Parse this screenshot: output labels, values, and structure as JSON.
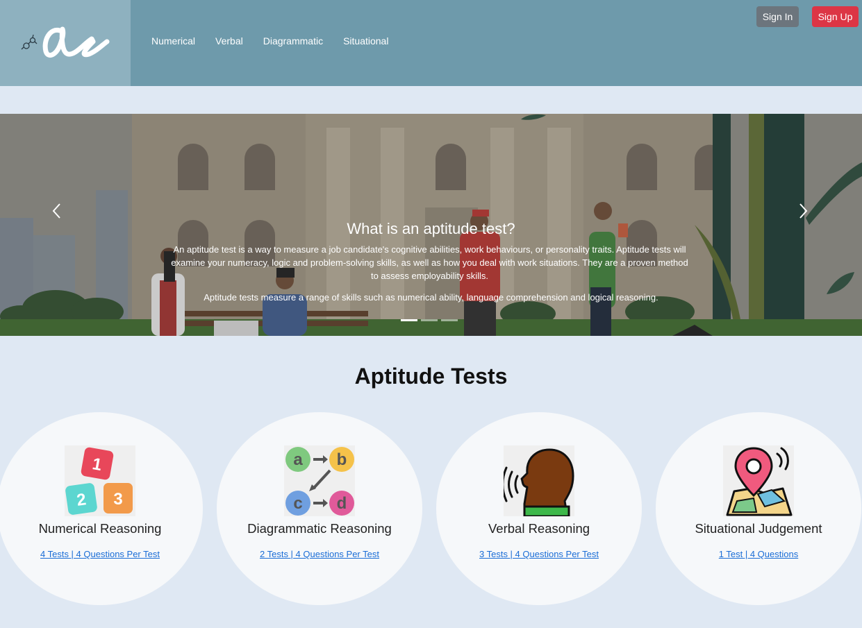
{
  "header": {
    "nav": [
      "Numerical",
      "Verbal",
      "Diagrammatic",
      "Situational"
    ],
    "sign_in": "Sign In",
    "sign_up": "Sign Up"
  },
  "hero": {
    "title": "What is an aptitude test?",
    "paragraph1": "An aptitude test is a way to measure a job candidate's cognitive abilities, work behaviours, or personality traits. Aptitude tests will examine your numeracy, logic and problem-solving skills, as well as how you deal with work situations. They are a proven method to assess employability skills.",
    "paragraph2": "Aptitude tests measure a range of skills such as numerical ability, language comprehension and logical reasoning.",
    "slides": 3,
    "active_slide": 1
  },
  "section": {
    "title": "Aptitude Tests"
  },
  "cards": [
    {
      "name": "Numerical Reasoning",
      "link": "4 Tests | 4 Questions Per Test",
      "icon": "number-blocks-icon"
    },
    {
      "name": "Diagrammatic Reasoning",
      "link": "2 Tests | 4 Questions Per Test",
      "icon": "abcd-diagram-icon"
    },
    {
      "name": "Verbal Reasoning",
      "link": "3 Tests | 4 Questions Per Test",
      "icon": "speaking-head-icon"
    },
    {
      "name": "Situational Judgement",
      "link": "1 Test | 4 Questions",
      "icon": "map-pin-icon"
    }
  ],
  "colors": {
    "header": "#6e9aab",
    "logo_bg": "#8eb1bf",
    "page_bg": "#dfe8f3",
    "sign_in": "#6c757d",
    "sign_up": "#dc3545",
    "link": "#1a6dd6"
  }
}
